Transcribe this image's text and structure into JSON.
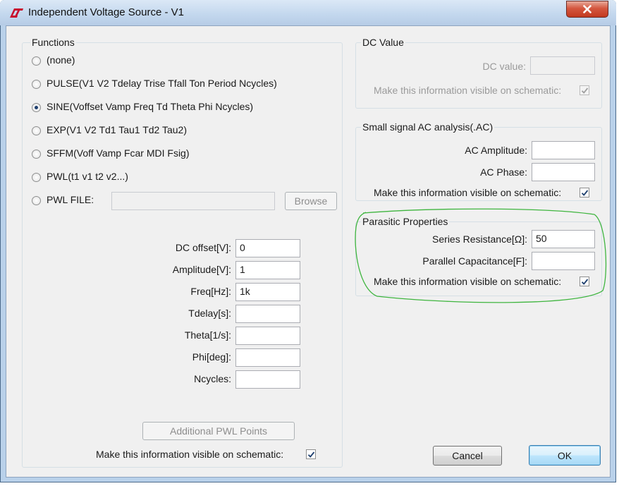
{
  "window": {
    "title": "Independent Voltage Source - V1"
  },
  "functions": {
    "legend": "Functions",
    "options": [
      {
        "label": "(none)",
        "selected": false
      },
      {
        "label": "PULSE(V1 V2 Tdelay Trise Tfall Ton Period Ncycles)",
        "selected": false
      },
      {
        "label": "SINE(Voffset Vamp Freq Td Theta Phi Ncycles)",
        "selected": true
      },
      {
        "label": "EXP(V1 V2 Td1 Tau1 Td2 Tau2)",
        "selected": false
      },
      {
        "label": "SFFM(Voff Vamp Fcar MDI Fsig)",
        "selected": false
      },
      {
        "label": "PWL(t1 v1 t2 v2...)",
        "selected": false
      },
      {
        "label": "PWL FILE:",
        "selected": false
      }
    ],
    "pwl_file_value": "",
    "browse_label": "Browse",
    "params": [
      {
        "label": "DC offset[V]:",
        "value": "0"
      },
      {
        "label": "Amplitude[V]:",
        "value": "1"
      },
      {
        "label": "Freq[Hz]:",
        "value": "1k"
      },
      {
        "label": "Tdelay[s]:",
        "value": ""
      },
      {
        "label": "Theta[1/s]:",
        "value": ""
      },
      {
        "label": "Phi[deg]:",
        "value": ""
      },
      {
        "label": "Ncycles:",
        "value": ""
      }
    ],
    "additional_pwl_label": "Additional PWL Points",
    "visible_label": "Make this information visible on schematic:",
    "visible_checked": true
  },
  "dc_value": {
    "legend": "DC Value",
    "field_label": "DC value:",
    "value": "",
    "visible_label": "Make this information visible on schematic:",
    "visible_checked": true
  },
  "ac": {
    "legend": "Small signal AC analysis(.AC)",
    "amplitude_label": "AC Amplitude:",
    "amplitude_value": "",
    "phase_label": "AC Phase:",
    "phase_value": "",
    "visible_label": "Make this information visible on schematic:",
    "visible_checked": true
  },
  "parasitic": {
    "legend": "Parasitic Properties",
    "series_label": "Series Resistance[Ω]:",
    "series_value": "50",
    "parallel_label": "Parallel Capacitance[F]:",
    "parallel_value": "",
    "visible_label": "Make this information visible on schematic:",
    "visible_checked": true
  },
  "buttons": {
    "cancel": "Cancel",
    "ok": "OK"
  },
  "colors": {
    "annotation": "#3fb53f",
    "title_bar": "#c4d8ee",
    "close": "#c2391f"
  }
}
